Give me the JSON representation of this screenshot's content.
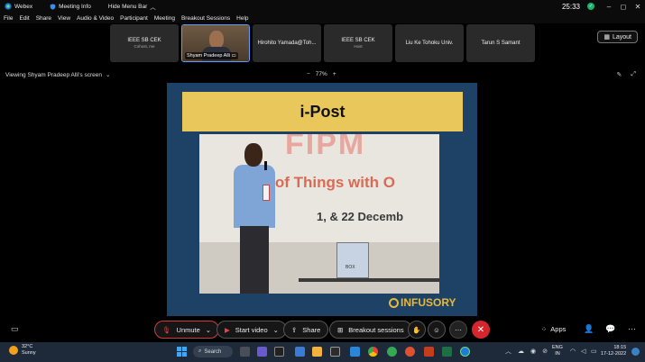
{
  "titlebar": {
    "app_name": "Webex",
    "meeting_info": "Meeting Info",
    "hide_menu": "Hide Menu Bar",
    "timer": "25:33",
    "window_controls": [
      "minimize-icon",
      "maximize-icon",
      "close-icon"
    ]
  },
  "menu": {
    "items": [
      "File",
      "Edit",
      "Share",
      "View",
      "Audio & Video",
      "Participant",
      "Meeting",
      "Breakout Sessions",
      "Help"
    ]
  },
  "participants": [
    {
      "name": "IEEE SB CEK",
      "sub": "Cohost, me",
      "active": false
    },
    {
      "name": "Shyam Pradeep Alli",
      "sub": "",
      "active": true
    },
    {
      "name": "Hirohito Yamada@Toh...",
      "sub": "",
      "active": false
    },
    {
      "name": "IEEE SB CEK",
      "sub": "Host",
      "active": false
    },
    {
      "name": "Liu Ke Tohoku Univ.",
      "sub": "",
      "active": false
    },
    {
      "name": "Tarun S Samant",
      "sub": "",
      "active": false
    }
  ],
  "layout_label": "Layout",
  "viewing": {
    "label": "Viewing Shyam Pradeep Alli's screen",
    "zoom": "77%"
  },
  "shared_content": {
    "heading": "i-Post",
    "photo_banner_1": "FIPM",
    "photo_banner_2": "rnet of Things with O",
    "photo_banner_3": "1, & 22 Decemb",
    "device_label": "BOX",
    "logo_text": "INFUSORY"
  },
  "controls": {
    "unmute": "Unmute",
    "start_video": "Start video",
    "share": "Share",
    "breakout": "Breakout sessions",
    "apps": "Apps"
  },
  "taskbar": {
    "temperature": "32°C",
    "weather": "Sunny",
    "search": "Search",
    "lang_1": "ENG",
    "lang_2": "IN",
    "time": "18:15",
    "date": "17-12-2022"
  },
  "colors": {
    "accent_blue": "#5a9cff",
    "end_red": "#d6262d",
    "ipost_yellow": "#e9c75b",
    "slide_blue": "#1d4266"
  }
}
